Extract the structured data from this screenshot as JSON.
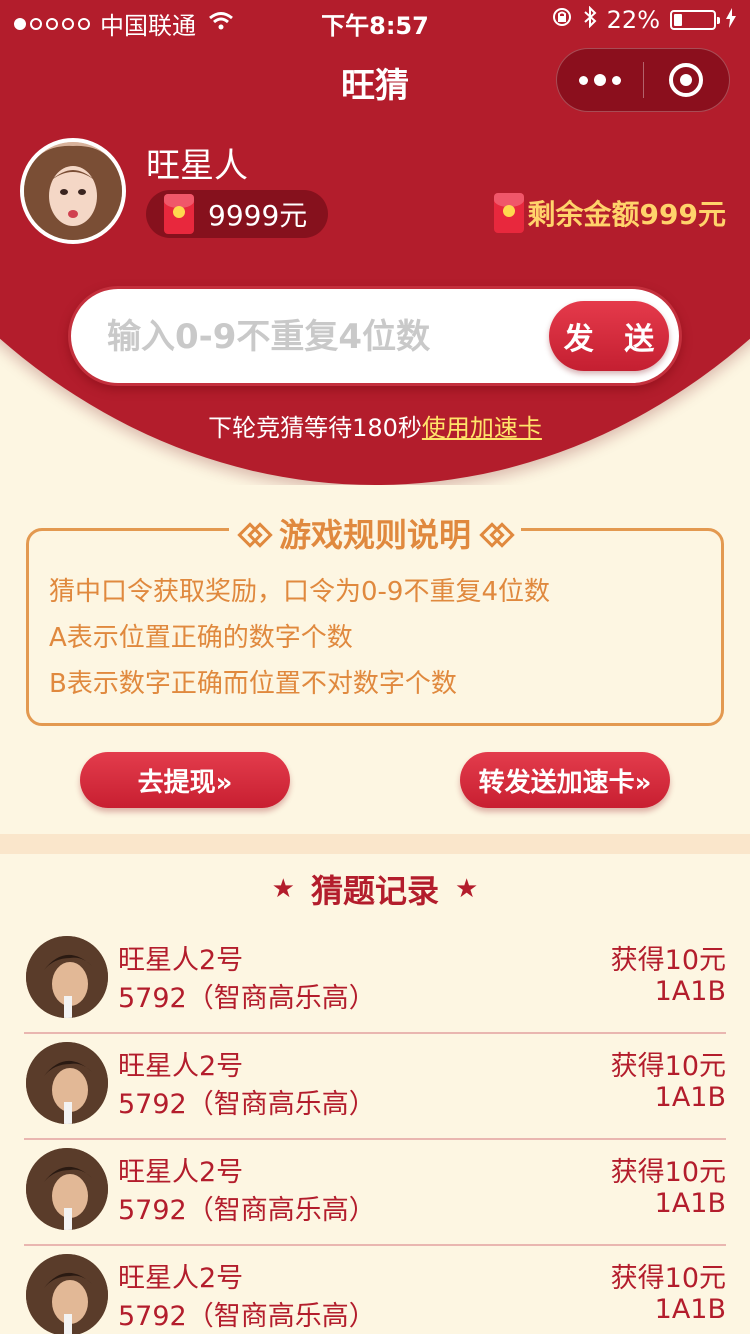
{
  "status": {
    "carrier": "中国联通",
    "time": "下午8:57",
    "battery": "22%",
    "battery_level": 0.22
  },
  "nav": {
    "title": "旺猜"
  },
  "user": {
    "name": "旺星人",
    "balance": "9999元",
    "remaining": "剩余金额999元"
  },
  "guess": {
    "placeholder": "输入0-9不重复4位数",
    "send_label": "发 送"
  },
  "wait": {
    "text": "下轮竞猜等待180秒",
    "link": "使用加速卡"
  },
  "rules": {
    "title": "游戏规则说明",
    "items": [
      "猜中口令获取奖励，口令为0-9不重复4位数",
      "A表示位置正确的数字个数",
      "B表示数字正确而位置不对数字个数"
    ]
  },
  "actions": {
    "withdraw": "去提现»",
    "forward": "转发送加速卡»"
  },
  "records": {
    "title": "猜题记录",
    "items": [
      {
        "name": "旺星人2号",
        "guess": "5792（智商高乐高）",
        "reward": "获得10元",
        "result": "1A1B"
      },
      {
        "name": "旺星人2号",
        "guess": "5792（智商高乐高）",
        "reward": "获得10元",
        "result": "1A1B"
      },
      {
        "name": "旺星人2号",
        "guess": "5792（智商高乐高）",
        "reward": "获得10元",
        "result": "1A1B"
      },
      {
        "name": "旺星人2号",
        "guess": "5792（智商高乐高）",
        "reward": "获得10元",
        "result": "1A1B"
      }
    ]
  },
  "colors": {
    "primary": "#b31d2c",
    "accent": "#e0893e",
    "background": "#fdf6e2",
    "gold": "#ffd36b"
  }
}
